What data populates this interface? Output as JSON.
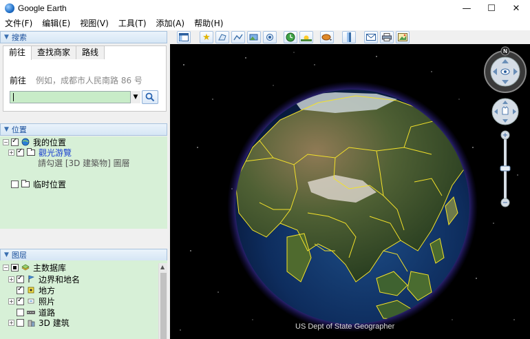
{
  "window": {
    "title": "Google Earth",
    "minimize_glyph": "—",
    "maximize_glyph": "☐",
    "close_glyph": "✕"
  },
  "menu": [
    "文件(F)",
    "编辑(E)",
    "视图(V)",
    "工具(T)",
    "添加(A)",
    "帮助(H)"
  ],
  "search": {
    "header": "搜索",
    "tabs": [
      "前往",
      "查找商家",
      "路线"
    ],
    "goto_label": "前往",
    "hint": "例如，成都市人民南路 86 号",
    "input_value": ""
  },
  "places": {
    "header": "位置",
    "items": [
      {
        "label": "我的位置"
      },
      {
        "label": "觀光游覽"
      },
      {
        "label": "請勾選 [3D 建築物] 圖層"
      },
      {
        "label": "临时位置"
      }
    ]
  },
  "layers": {
    "header": "图层",
    "items": [
      {
        "label": "主数据库"
      },
      {
        "label": "边界和地名"
      },
      {
        "label": "地方"
      },
      {
        "label": "照片"
      },
      {
        "label": "道路"
      },
      {
        "label": "3D 建筑"
      }
    ]
  },
  "toolbar_icons": [
    "sidebar-toggle-icon",
    "placemark-icon",
    "polygon-icon",
    "path-icon",
    "image-overlay-icon",
    "record-tour-icon",
    "historical-imagery-icon",
    "sunlight-icon",
    "planets-icon",
    "ruler-icon",
    "email-icon",
    "print-icon",
    "save-image-icon"
  ],
  "map": {
    "copyright": "US Dept of State Geographer",
    "compass_letter": "N"
  },
  "colors": {
    "panel_green": "#d7f0d7",
    "header_text": "#1a4f9c",
    "border_yellow": "#f4e22a",
    "atmosphere": "#6a5cff",
    "link_blue": "#1a3fd1"
  }
}
